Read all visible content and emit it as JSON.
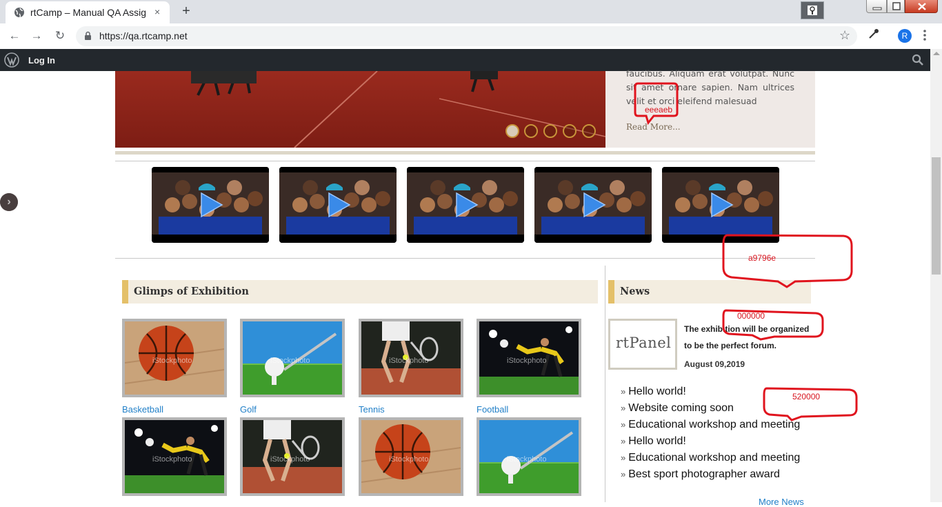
{
  "browser": {
    "tab_title": "rtCamp – Manual QA Assig",
    "tab_close": "×",
    "new_tab": "+",
    "url": "https://qa.rtcamp.net",
    "profile_initial": "R"
  },
  "admin_bar": {
    "login": "Log In"
  },
  "slider": {
    "body_text": "faucibus. Aliquam erat volutpat. Nunc sit amet ornare sapien. Nam ultrices velit et orci eleifend malesuad",
    "read_more": "Read More...",
    "dots": 5,
    "active_dot": 1
  },
  "video_carousel": {
    "prev": "‹",
    "next": "›",
    "video_count": 5
  },
  "gallery": {
    "heading": "Glimps of Exhibition",
    "items": [
      {
        "label": "Basketball",
        "image": "basketball"
      },
      {
        "label": "Golf",
        "image": "golf"
      },
      {
        "label": "Tennis",
        "image": "tennis"
      },
      {
        "label": "Football",
        "image": "football"
      },
      {
        "label": "",
        "image": "football"
      },
      {
        "label": "",
        "image": "tennis"
      },
      {
        "label": "",
        "image": "basketball"
      },
      {
        "label": "",
        "image": "golf"
      }
    ],
    "watermark": "iStockphoto"
  },
  "news": {
    "heading": "News",
    "logo_text": "rtPanel",
    "featured_title": "The exhibition will be organized to be the perfect forum.",
    "featured_date": "August 09,2019",
    "items": [
      "Hello world!",
      "Website coming soon",
      "Educational workshop and meeting",
      "Hello world!",
      "Educational workshop and meeting",
      "Best sport photographer award"
    ],
    "more": "More News"
  },
  "annotations": [
    "eeeaeb",
    "a9796e",
    "000000",
    "520000"
  ],
  "colors": {
    "annotation": "#d8141e",
    "link": "#2280c8",
    "heading_accent": "#e4c069",
    "heading_bg": "#f3ede0",
    "admin_bar": "#23282d"
  }
}
